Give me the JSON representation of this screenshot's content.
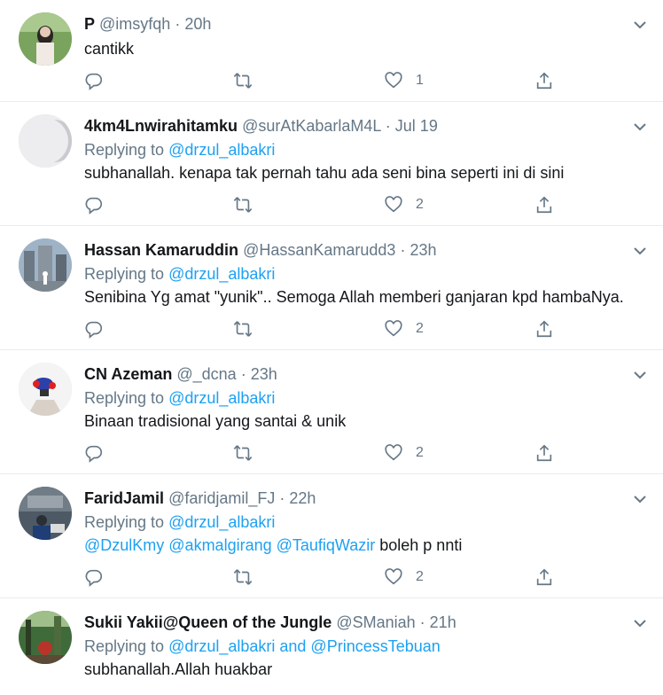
{
  "tweets": [
    {
      "name": "P",
      "handle": "@imsyfqh",
      "time": "20h",
      "replying_prefix": "",
      "replying_to": "",
      "text_before": "",
      "mentions": "",
      "text": "cantikk",
      "reply_count": "",
      "retweet_count": "",
      "like_count": "1"
    },
    {
      "name": "4km4Lnwirahitamku",
      "handle": "@surAtKabarlaM4L",
      "time": "Jul 19",
      "replying_prefix": "Replying to ",
      "replying_to": "@drzul_albakri",
      "text_before": "",
      "mentions": "",
      "text": "subhanallah. kenapa tak pernah tahu ada seni bina seperti ini di sini",
      "reply_count": "",
      "retweet_count": "",
      "like_count": "2"
    },
    {
      "name": "Hassan Kamaruddin",
      "handle": "@HassanKamarudd3",
      "time": "23h",
      "replying_prefix": "Replying to ",
      "replying_to": "@drzul_albakri",
      "text_before": "",
      "mentions": "",
      "text": "Senibina Yg amat \"yunik\".. Semoga Allah memberi ganjaran kpd hambaNya.",
      "reply_count": "",
      "retweet_count": "",
      "like_count": "2"
    },
    {
      "name": "CN Azeman",
      "handle": "@_dcna",
      "time": "23h",
      "replying_prefix": "Replying to ",
      "replying_to": "@drzul_albakri",
      "text_before": "",
      "mentions": "",
      "text": "Binaan tradisional yang santai & unik",
      "reply_count": "",
      "retweet_count": "",
      "like_count": "2"
    },
    {
      "name": "FaridJamil",
      "handle": "@faridjamil_FJ",
      "time": "22h",
      "replying_prefix": "Replying to ",
      "replying_to": "@drzul_albakri",
      "text_before": "",
      "mentions": "@DzulKmy @akmalgirang @TaufiqWazir",
      "text": " boleh p nnti",
      "reply_count": "",
      "retweet_count": "",
      "like_count": "2"
    },
    {
      "name": "Sukii Yakii@Queen of the Jungle",
      "handle": "@SManiah",
      "time": "21h",
      "replying_prefix": "Replying to ",
      "replying_to": "@drzul_albakri and @PrincessTebuan",
      "text_before": "",
      "mentions": "",
      "text": "subhanallah.Allah huakbar",
      "reply_count": "",
      "retweet_count": "",
      "like_count": ""
    }
  ],
  "separator": "·",
  "colors": {
    "link": "#1da1f2",
    "muted": "#657786",
    "text": "#14171a",
    "border": "#e6ecf0"
  },
  "icons": {
    "caret": "chevron-down-icon",
    "reply": "reply-icon",
    "retweet": "retweet-icon",
    "like": "heart-icon",
    "share": "share-icon"
  }
}
